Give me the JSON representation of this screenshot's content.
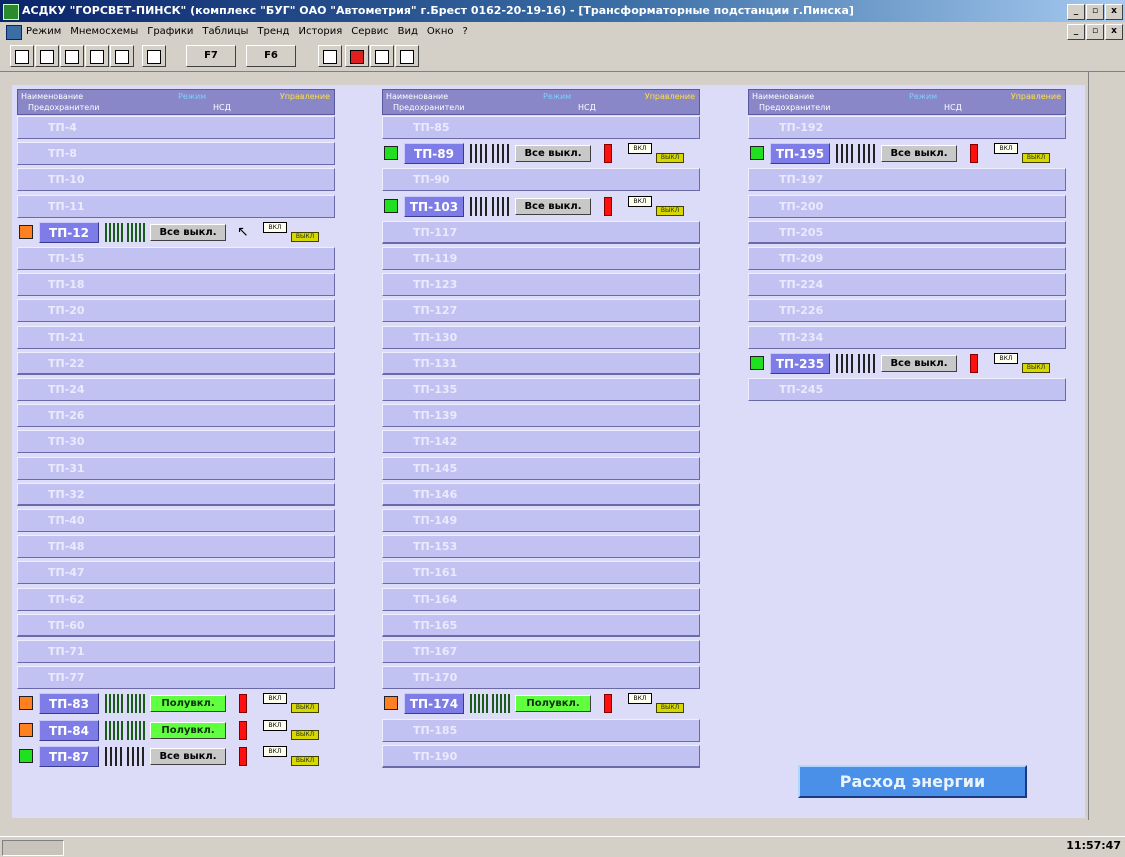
{
  "window": {
    "title": "АСДКУ \"ГОРСВЕТ-ПИНСК\" (комплекс \"БУГ\" ОАО \"Автометрия\" г.Брест 0162-20-19-16) - [Трансформаторные подстанции г.Пинска]",
    "min": "_",
    "restore": "▫",
    "close": "x"
  },
  "menu": [
    "Режим",
    "Мнемосхемы",
    "Графики",
    "Таблицы",
    "Тренд",
    "История",
    "Сервис",
    "Вид",
    "Окно",
    "?"
  ],
  "toolbar": {
    "f7": "F7",
    "f6": "F6"
  },
  "headers": {
    "name": "Наименование",
    "mode": "Режим",
    "control": "Управление",
    "fuses": "Предохранители",
    "nsd": "НСД"
  },
  "states": {
    "all_off": "Все выкл.",
    "partial": "Полувкл."
  },
  "ctl": {
    "on": "ВКЛ",
    "off": "ВЫКЛ"
  },
  "columns": [
    {
      "rows": [
        {
          "name": "ТП-4"
        },
        {
          "name": "ТП-8"
        },
        {
          "name": "ТП-10"
        },
        {
          "name": "ТП-11"
        },
        {
          "name": "ТП-12",
          "active": true,
          "indicator": "orange",
          "fuse": "zig",
          "state": "all_off",
          "alarm": "arrow"
        },
        {
          "name": "ТП-15"
        },
        {
          "name": "ТП-18"
        },
        {
          "name": "ТП-20"
        },
        {
          "name": "ТП-21"
        },
        {
          "name": "ТП-22"
        },
        {
          "name": "ТП-24"
        },
        {
          "name": "ТП-26"
        },
        {
          "name": "ТП-30"
        },
        {
          "name": "ТП-31"
        },
        {
          "name": "ТП-32"
        },
        {
          "name": "ТП-40"
        },
        {
          "name": "ТП-48"
        },
        {
          "name": "ТП-47"
        },
        {
          "name": "ТП-62"
        },
        {
          "name": "ТП-60"
        },
        {
          "name": "ТП-71"
        },
        {
          "name": "ТП-77"
        },
        {
          "name": "ТП-83",
          "active": true,
          "indicator": "orange",
          "fuse": "zig",
          "state": "partial",
          "alarm": "red"
        },
        {
          "name": "ТП-84",
          "active": true,
          "indicator": "orange",
          "fuse": "zig",
          "state": "partial",
          "alarm": "red"
        },
        {
          "name": "ТП-87",
          "active": true,
          "indicator": "green",
          "fuse": "bar",
          "state": "all_off",
          "alarm": "red"
        }
      ]
    },
    {
      "rows": [
        {
          "name": "ТП-85"
        },
        {
          "name": "ТП-89",
          "active": true,
          "indicator": "green",
          "fuse": "bar",
          "state": "all_off",
          "alarm": "red"
        },
        {
          "name": "ТП-90"
        },
        {
          "name": "ТП-103",
          "active": true,
          "indicator": "green",
          "fuse": "bar",
          "state": "all_off",
          "alarm": "red"
        },
        {
          "name": "ТП-117"
        },
        {
          "name": "ТП-119"
        },
        {
          "name": "ТП-123"
        },
        {
          "name": "ТП-127"
        },
        {
          "name": "ТП-130"
        },
        {
          "name": "ТП-131"
        },
        {
          "name": "ТП-135"
        },
        {
          "name": "ТП-139"
        },
        {
          "name": "ТП-142"
        },
        {
          "name": "ТП-145"
        },
        {
          "name": "ТП-146"
        },
        {
          "name": "ТП-149"
        },
        {
          "name": "ТП-153"
        },
        {
          "name": "ТП-161"
        },
        {
          "name": "ТП-164"
        },
        {
          "name": "ТП-165"
        },
        {
          "name": "ТП-167"
        },
        {
          "name": "ТП-170"
        },
        {
          "name": "ТП-174",
          "active": true,
          "indicator": "orange",
          "fuse": "zig",
          "state": "partial",
          "alarm": "red"
        },
        {
          "name": "ТП-185"
        },
        {
          "name": "ТП-190"
        }
      ]
    },
    {
      "rows": [
        {
          "name": "ТП-192"
        },
        {
          "name": "ТП-195",
          "active": true,
          "indicator": "green",
          "fuse": "bar",
          "state": "all_off",
          "alarm": "red"
        },
        {
          "name": "ТП-197"
        },
        {
          "name": "ТП-200"
        },
        {
          "name": "ТП-205"
        },
        {
          "name": "ТП-209"
        },
        {
          "name": "ТП-224"
        },
        {
          "name": "ТП-226"
        },
        {
          "name": "ТП-234"
        },
        {
          "name": "ТП-235",
          "active": true,
          "indicator": "green",
          "fuse": "bar",
          "state": "all_off",
          "alarm": "red"
        },
        {
          "name": "ТП-245"
        }
      ]
    }
  ],
  "energy_button": "Расход энергии",
  "clock": "11:57:47"
}
